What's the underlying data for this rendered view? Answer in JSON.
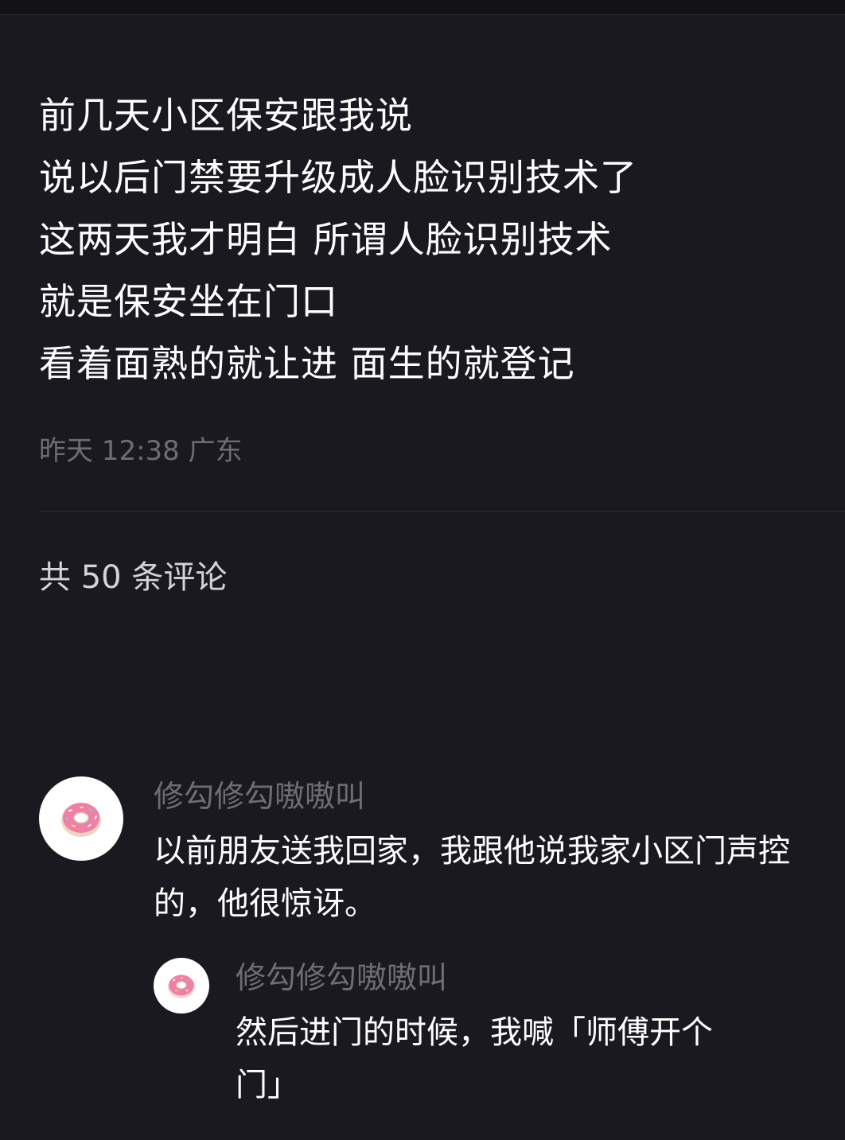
{
  "post": {
    "lines": [
      "前几天小区保安跟我说",
      "说以后门禁要升级成人脸识别技术了",
      "这两天我才明白 所谓人脸识别技术",
      "就是保安坐在门口",
      "看着面熟的就让进 面生的就登记"
    ],
    "meta": "昨天 12:38 广东"
  },
  "comments": {
    "count_label": "共 50 条评论",
    "main": {
      "username": "修勾修勾嗷嗷叫",
      "text": "以前朋友送我回家，我跟他说我家小区门声控的，他很惊讶。",
      "avatar_icon": "donut-icon"
    },
    "reply": {
      "username": "修勾修勾嗷嗷叫",
      "text": "然后进门的时候，我喊「师傅开个门」",
      "avatar_icon": "donut-icon"
    }
  },
  "colors": {
    "background": "#1a191f",
    "primary_text": "#ffffff",
    "secondary_text": "#6e6d74",
    "donut_frosting": "#f07fa6"
  }
}
